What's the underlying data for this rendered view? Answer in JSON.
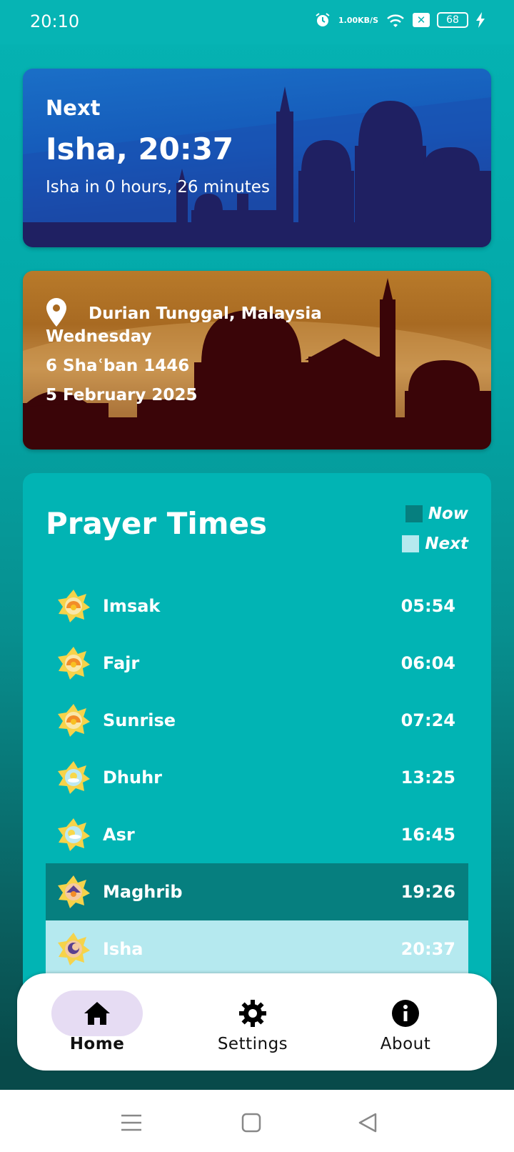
{
  "status_bar": {
    "time": "20:10",
    "speed_value": "1.00",
    "speed_unit": "KB/S",
    "battery": "68"
  },
  "next_card": {
    "label": "Next",
    "title": "Isha, 20:37",
    "subtitle": "Isha in 0 hours, 26 minutes"
  },
  "location_card": {
    "location": "Durian Tunggal, Malaysia",
    "weekday": "Wednesday",
    "hijri_date": "6 Shaʿban 1446",
    "gregorian_date": "5 February 2025"
  },
  "prayer_times": {
    "title": "Prayer Times",
    "legend": {
      "now_label": "Now",
      "now_color": "#067f7f",
      "next_label": "Next",
      "next_color": "#b5e9ef"
    },
    "items": [
      {
        "name": "Imsak",
        "time": "05:54",
        "icon": "sunrise-star-icon",
        "state": ""
      },
      {
        "name": "Fajr",
        "time": "06:04",
        "icon": "sunrise-star-icon",
        "state": ""
      },
      {
        "name": "Sunrise",
        "time": "07:24",
        "icon": "sunrise-star-icon",
        "state": ""
      },
      {
        "name": "Dhuhr",
        "time": "13:25",
        "icon": "sun-cloud-star-icon",
        "state": ""
      },
      {
        "name": "Asr",
        "time": "16:45",
        "icon": "sun-cloud-star-icon",
        "state": ""
      },
      {
        "name": "Maghrib",
        "time": "19:26",
        "icon": "sunset-star-icon",
        "state": "now"
      },
      {
        "name": "Isha",
        "time": "20:37",
        "icon": "moon-star-icon",
        "state": "next"
      }
    ]
  },
  "bottom_nav": {
    "home": "Home",
    "settings": "Settings",
    "about": "About",
    "active": "home"
  }
}
